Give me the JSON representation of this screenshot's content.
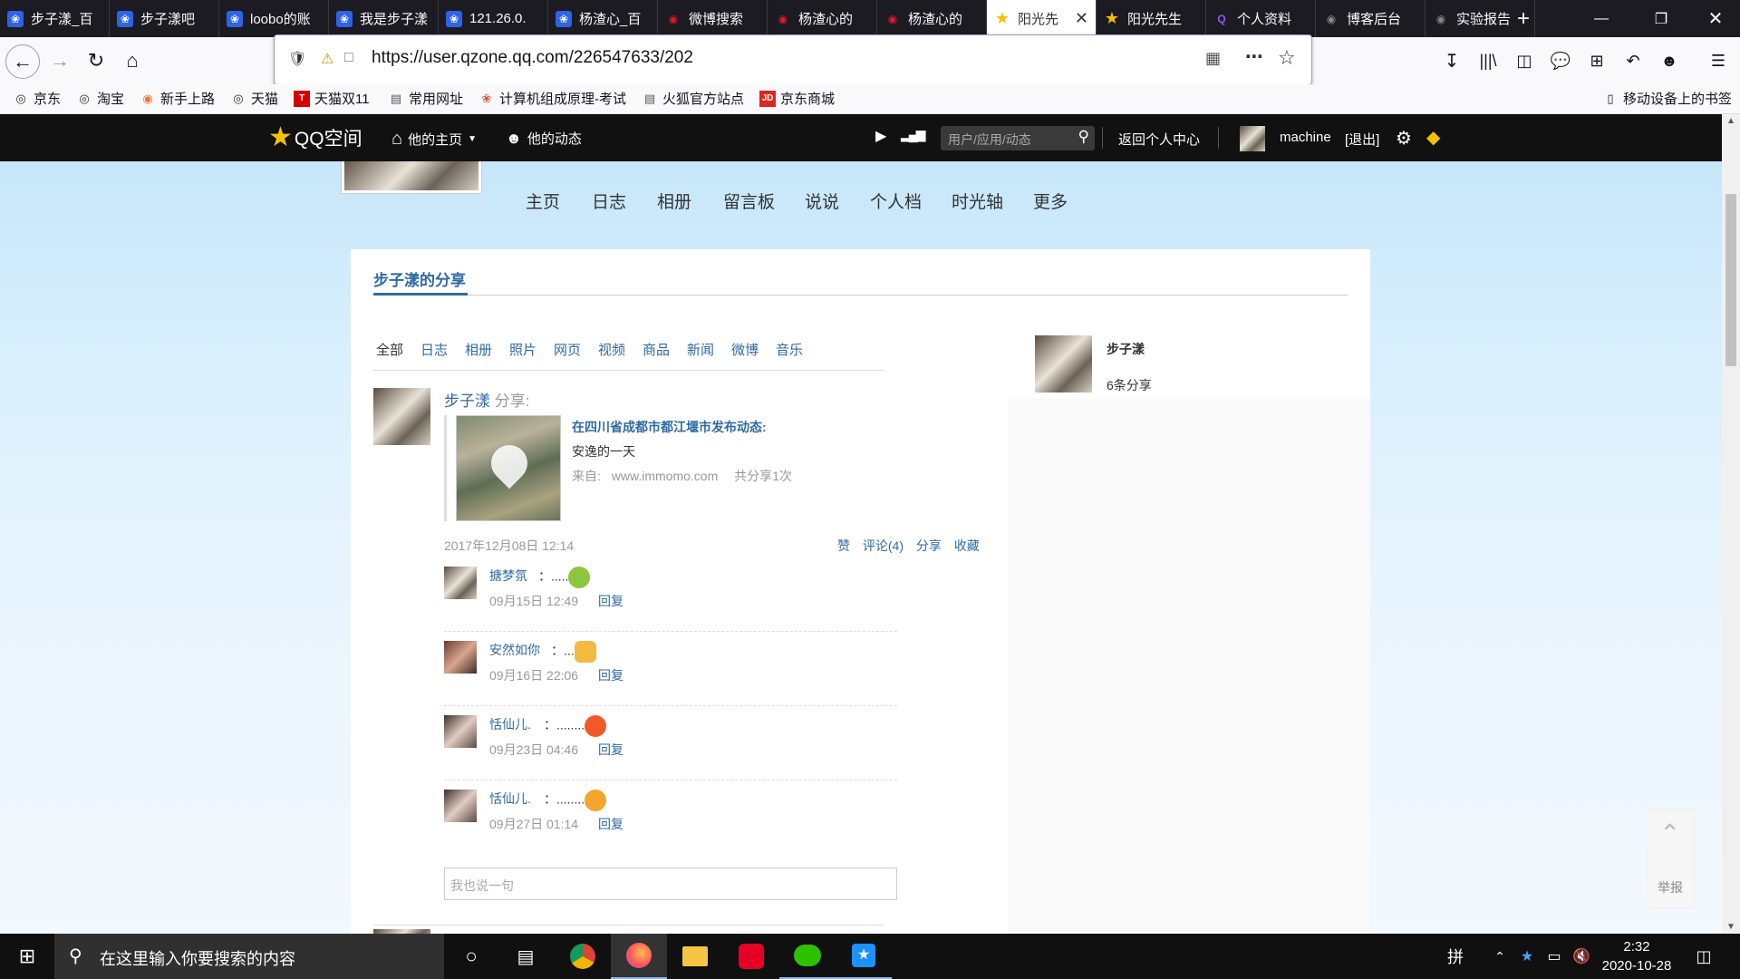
{
  "browser": {
    "tabs": [
      {
        "title": "步子漾_百",
        "icon": "baidu-icon"
      },
      {
        "title": "步子漾吧",
        "icon": "baidu-icon"
      },
      {
        "title": "loobo的账",
        "icon": "baidu-icon"
      },
      {
        "title": "我是步子漾",
        "icon": "baidu-icon"
      },
      {
        "title": "121.26.0.",
        "icon": "baidu-icon"
      },
      {
        "title": "杨渣心_百",
        "icon": "baidu-icon"
      },
      {
        "title": "微博搜索",
        "icon": "weibo-icon"
      },
      {
        "title": "杨渣心的",
        "icon": "weibo-icon"
      },
      {
        "title": "杨渣心的",
        "icon": "weibo-icon"
      },
      {
        "title": "阳光先",
        "icon": "qzone-star-icon",
        "active": true
      },
      {
        "title": "阳光先生",
        "icon": "qzone-star-icon"
      },
      {
        "title": "个人资料",
        "icon": "q-icon"
      },
      {
        "title": "博客后台",
        "icon": "github-icon"
      },
      {
        "title": "实验报告",
        "icon": "github-icon"
      }
    ],
    "new_tab_label": "+",
    "url": "https://user.qzone.qq.com/226547633/202",
    "bookmarks": [
      {
        "label": "京东",
        "icon": "globe-icon"
      },
      {
        "label": "淘宝",
        "icon": "globe-icon"
      },
      {
        "label": "新手上路",
        "icon": "firefox-icon"
      },
      {
        "label": "天猫",
        "icon": "globe-icon"
      },
      {
        "label": "天猫双11",
        "icon": "tmall-icon",
        "badge": "T"
      },
      {
        "label": "常用网址",
        "icon": "folder-icon"
      },
      {
        "label": "计算机组成原理-考试",
        "icon": "chaoxing-icon"
      },
      {
        "label": "火狐官方站点",
        "icon": "folder-icon"
      },
      {
        "label": "京东商城",
        "icon": "jd-icon",
        "badge": "JD"
      }
    ],
    "mobile_bookmarks": "移动设备上的书签"
  },
  "qzone_bar": {
    "logo": "QQ空间",
    "his_home": "他的主页",
    "his_feed": "他的动态",
    "search_placeholder": "用户/应用/动态",
    "back_center": "返回个人中心",
    "username": "machine",
    "logout": "[退出]"
  },
  "main_nav": [
    "主页",
    "日志",
    "相册",
    "留言板",
    "说说",
    "个人档",
    "时光轴",
    "更多"
  ],
  "share": {
    "title": "步子漾的分享",
    "filters": [
      "全部",
      "日志",
      "相册",
      "照片",
      "网页",
      "视频",
      "商品",
      "新闻",
      "微博",
      "音乐"
    ],
    "post": {
      "author": "步子漾",
      "action": "分享:",
      "headline": "在四川省成都市都江堰市发布动态:",
      "body": "安逸的一天",
      "source_label": "来自:",
      "source": "www.immomo.com",
      "share_count": "共分享1次",
      "time": "2017年12月08日 12:14",
      "actions": [
        "赞",
        "评论(4)",
        "分享",
        "收藏"
      ]
    },
    "comments": [
      {
        "name": "搪梦氛",
        "text": "：.....",
        "time": "09月15日 12:49",
        "reply": "回复",
        "emoji_color": "#8cc63f"
      },
      {
        "name": "安然如你",
        "text": "：...",
        "time": "09月16日 22:06",
        "reply": "回复",
        "emoji_color": "#f4b942"
      },
      {
        "name": "恬仙儿.",
        "text": "：........",
        "time": "09月23日 04:46",
        "reply": "回复",
        "emoji_color": "#f05a28"
      },
      {
        "name": "恬仙儿.",
        "text": "：........",
        "time": "09月27日 01:14",
        "reply": "回复",
        "emoji_color": "#f4a52c"
      }
    ],
    "comment_placeholder": "我也说一句"
  },
  "profile_box": {
    "name": "步子漾",
    "count": "6条分享"
  },
  "side_tools": {
    "report": "举报"
  },
  "taskbar": {
    "search_placeholder": "在这里输入你要搜索的内容",
    "ime": "拼",
    "time": "2:32",
    "date": "2020-10-28"
  }
}
